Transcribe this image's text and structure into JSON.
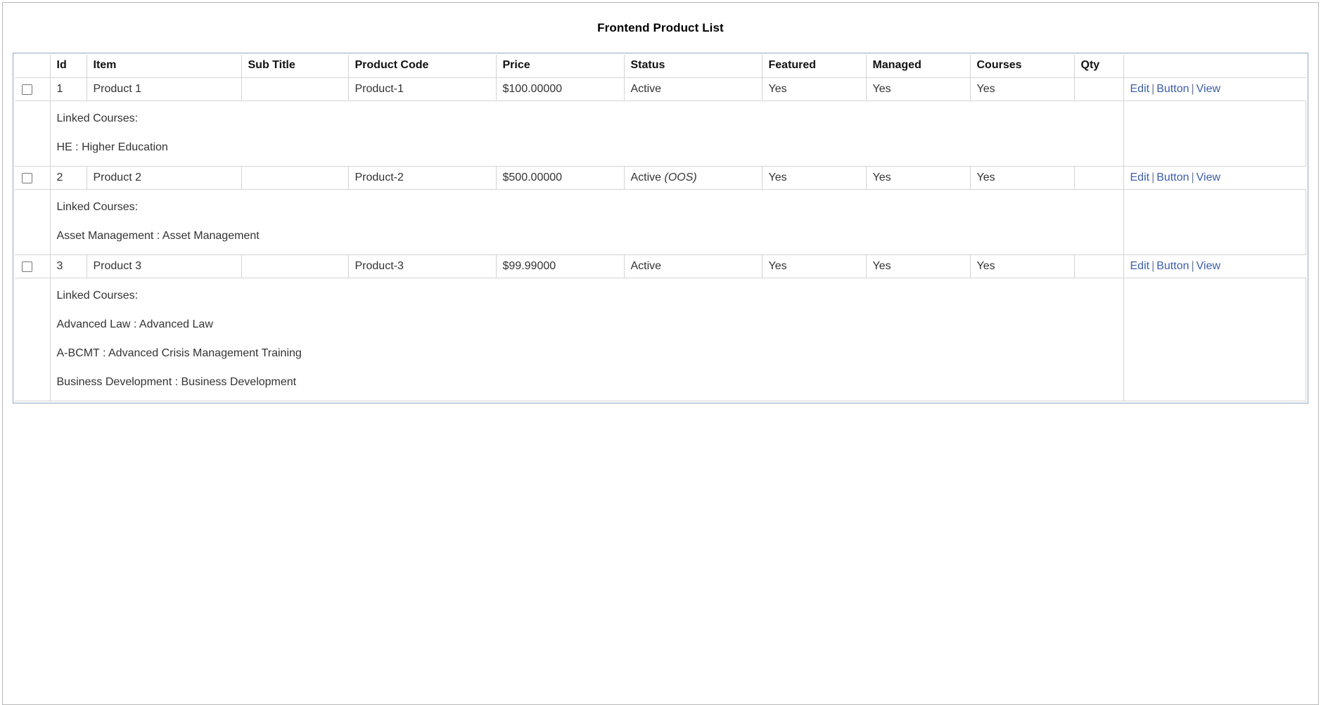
{
  "page": {
    "title": "Frontend Product List",
    "accent_border_color": "#8ea7c9",
    "link_color": "#3b5ea8",
    "text_color": "#333333"
  },
  "table": {
    "columns": [
      {
        "key": "check",
        "label": ""
      },
      {
        "key": "id",
        "label": "Id"
      },
      {
        "key": "item",
        "label": "Item"
      },
      {
        "key": "sub",
        "label": "Sub Title"
      },
      {
        "key": "code",
        "label": "Product Code"
      },
      {
        "key": "price",
        "label": "Price"
      },
      {
        "key": "status",
        "label": "Status"
      },
      {
        "key": "feat",
        "label": "Featured"
      },
      {
        "key": "man",
        "label": "Managed"
      },
      {
        "key": "courses",
        "label": "Courses"
      },
      {
        "key": "qty",
        "label": "Qty"
      },
      {
        "key": "actions",
        "label": ""
      }
    ],
    "actions": {
      "edit_label": "Edit",
      "button_label": "Button",
      "view_label": "View",
      "separator": "|"
    },
    "detail_heading": "Linked Courses:",
    "rows": [
      {
        "checked": false,
        "id": "1",
        "item": "Product 1",
        "sub_title": "",
        "product_code": "Product-1",
        "price": "$100.00000",
        "status": "Active",
        "status_note": "",
        "featured": "Yes",
        "managed": "Yes",
        "courses": "Yes",
        "qty": "",
        "linked_courses": [
          "HE : Higher Education"
        ]
      },
      {
        "checked": false,
        "id": "2",
        "item": "Product 2",
        "sub_title": "",
        "product_code": "Product-2",
        "price": "$500.00000",
        "status": "Active",
        "status_note": "(OOS)",
        "featured": "Yes",
        "managed": "Yes",
        "courses": "Yes",
        "qty": "",
        "linked_courses": [
          "Asset Management : Asset Management"
        ]
      },
      {
        "checked": false,
        "id": "3",
        "item": "Product 3",
        "sub_title": "",
        "product_code": "Product-3",
        "price": "$99.99000",
        "status": "Active",
        "status_note": "",
        "featured": "Yes",
        "managed": "Yes",
        "courses": "Yes",
        "qty": "",
        "linked_courses": [
          "Advanced Law : Advanced Law",
          "A-BCMT : Advanced Crisis Management Training",
          "Business Development : Business Development"
        ]
      }
    ]
  }
}
